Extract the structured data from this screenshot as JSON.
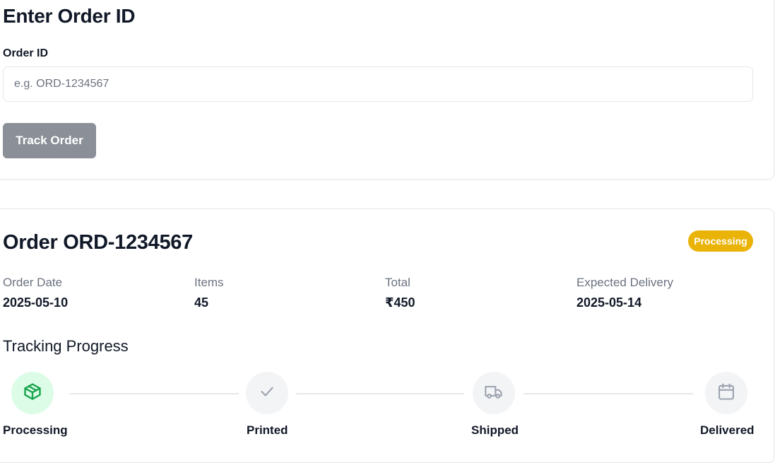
{
  "search_section": {
    "title": "Enter Order ID",
    "field_label": "Order ID",
    "input_value": "",
    "input_placeholder": "e.g. ORD-1234567",
    "track_button_label": "Track Order"
  },
  "order": {
    "title": "Order ORD-1234567",
    "status_badge": "Processing",
    "status_color": "#eab308",
    "details": [
      {
        "label": "Order Date",
        "value": "2025-05-10"
      },
      {
        "label": "Items",
        "value": "45"
      },
      {
        "label": "Total",
        "value": "₹450"
      },
      {
        "label": "Expected Delivery",
        "value": "2025-05-14"
      }
    ]
  },
  "tracking": {
    "title": "Tracking Progress",
    "steps": [
      {
        "label": "Processing",
        "icon": "package-icon",
        "active": true
      },
      {
        "label": "Printed",
        "icon": "check-icon",
        "active": false
      },
      {
        "label": "Shipped",
        "icon": "truck-icon",
        "active": false
      },
      {
        "label": "Delivered",
        "icon": "calendar-icon",
        "active": false
      }
    ],
    "active_color": "#16a34a",
    "inactive_color": "#9ca3af"
  }
}
